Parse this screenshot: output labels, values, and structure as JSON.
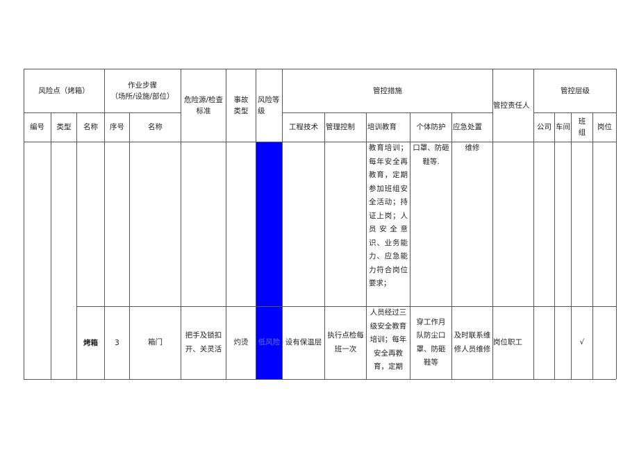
{
  "header": {
    "risk_point": "风险点（烤箱）",
    "work_steps": "作业步骤",
    "work_steps_sub": "（场所/设施/部位）",
    "hazard_standard": "危险源/检查标准",
    "accident_type": "事故类型",
    "risk_level": "风险等级",
    "control_measures": "管控措施",
    "responsible_person": "管控责任人",
    "control_level": "管控层级",
    "sub": {
      "code": "编号",
      "type": "类型",
      "name": "名称",
      "seq": "序号",
      "step_name": "名称",
      "engineering": "工程技术",
      "management": "管理控制",
      "training": "培训教育",
      "ppe": "个体防护",
      "emergency": "应急处置",
      "company": "公司",
      "workshop": "车间",
      "team": "班组",
      "post": "岗位"
    }
  },
  "colors": {
    "risk_low": "#0000ff"
  },
  "rows": [
    {
      "training": "教育培训；每年安全再教育，定期参加班组安全活动；持证上岗；人员安全意识、业务能力、应急能力符合岗位要求；",
      "ppe": "口罩、防砸鞋等.",
      "emergency": "维修"
    },
    {
      "name": "烤箱",
      "seq": "3",
      "step_name": "箱门",
      "hazard": "把手及锁扣开、关灵活",
      "accident": "灼烫",
      "risk_level": "低风险",
      "engineering": "设有保温层",
      "management": "执行点检每班一次",
      "training": "人员经过三级安全教育培训；每年安全再教育，定期",
      "ppe": "穿工作月队防尘口罩、防砸鞋等",
      "emergency": "及时联系维修人员维修",
      "responsible": "岗位职工",
      "company": "",
      "workshop": "",
      "team": "√",
      "post": ""
    }
  ]
}
